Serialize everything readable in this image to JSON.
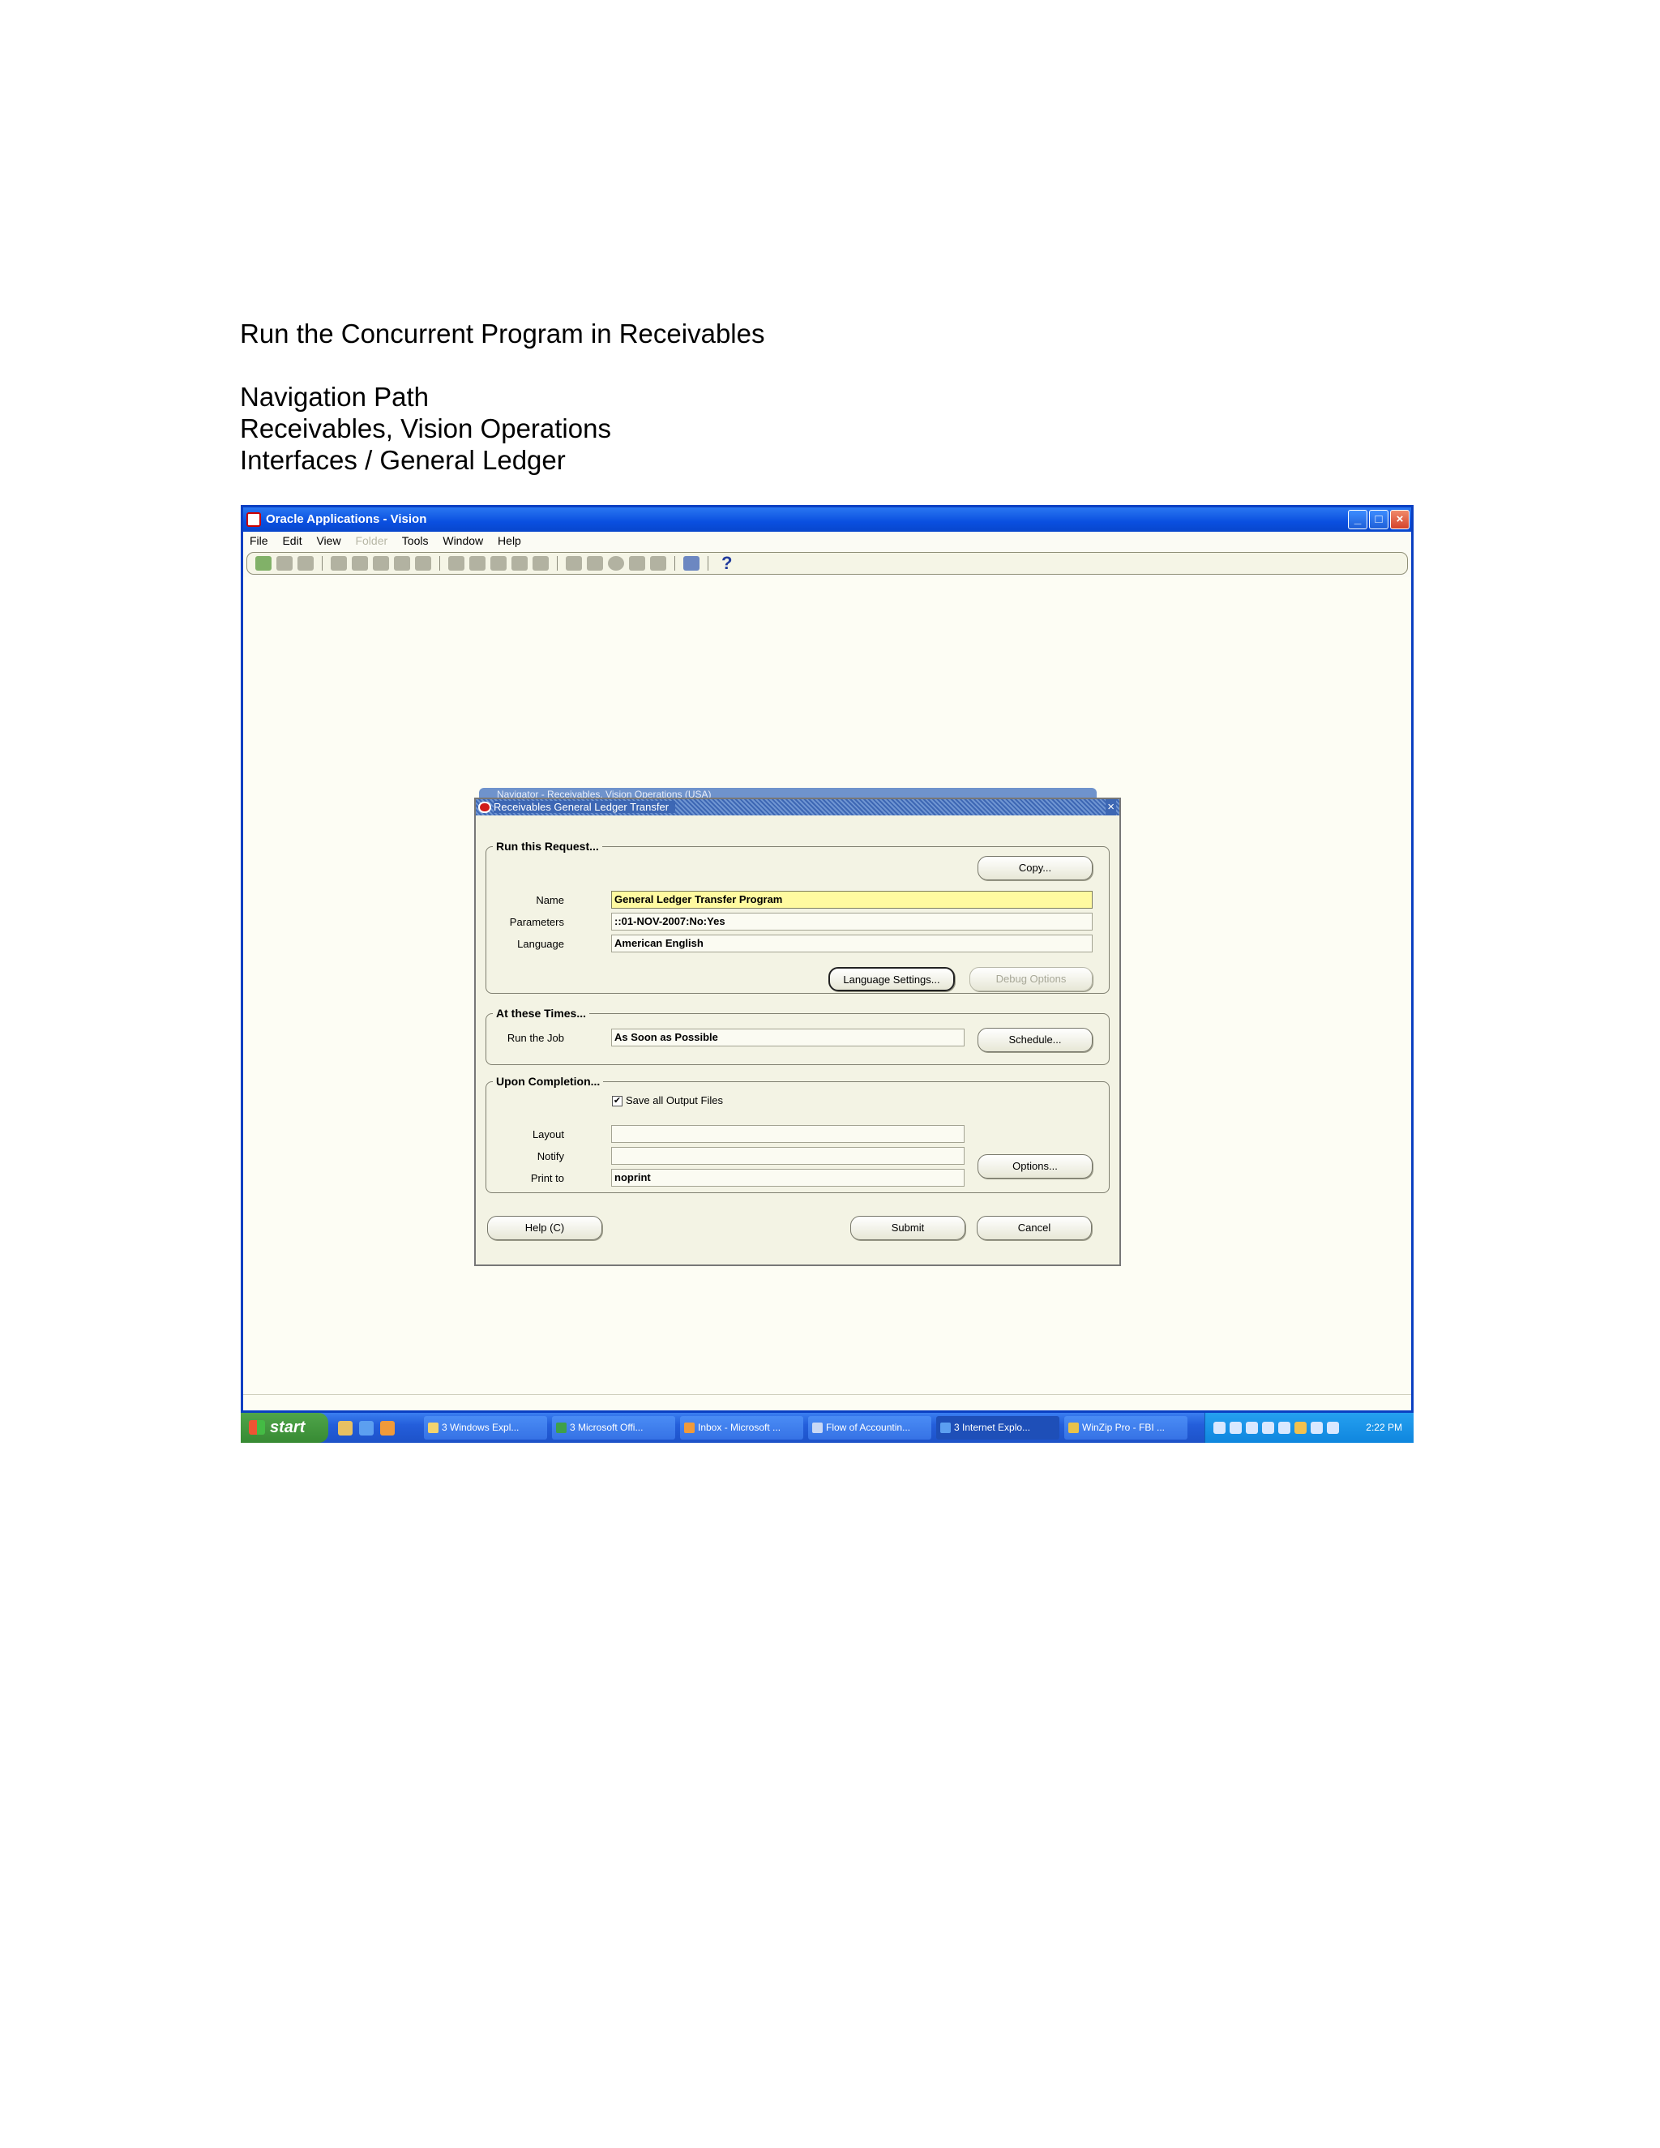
{
  "document": {
    "title": "Run the Concurrent Program in Receivables",
    "nav_heading": "Navigation Path",
    "nav_line_1": "Receivables, Vision Operations",
    "nav_line_2": "Interfaces / General Ledger"
  },
  "app": {
    "title": "Oracle Applications - Vision",
    "menu": [
      "File",
      "Edit",
      "View",
      "Folder",
      "Tools",
      "Window",
      "Help"
    ],
    "help_glyph": "?"
  },
  "navigator": {
    "title": "Navigator - Receivables, Vision Operations (USA)"
  },
  "dialog": {
    "title": "Receivables General Ledger Transfer",
    "close": "×",
    "run_section": {
      "legend": "Run this Request...",
      "copy_button": "Copy...",
      "name_label": "Name",
      "name_value": "General Ledger Transfer Program",
      "parameters_label": "Parameters",
      "parameters_value": "::01-NOV-2007:No:Yes",
      "language_label": "Language",
      "language_value": "American English",
      "language_settings_button": "Language Settings...",
      "debug_options_button": "Debug Options"
    },
    "times_section": {
      "legend": "At these Times...",
      "run_job_label": "Run the Job",
      "run_job_value": "As Soon as Possible",
      "schedule_button": "Schedule..."
    },
    "completion_section": {
      "legend": "Upon Completion...",
      "save_output_label": "Save all Output Files",
      "save_output_checked": "✔",
      "layout_label": "Layout",
      "layout_value": "",
      "notify_label": "Notify",
      "notify_value": "",
      "print_to_label": "Print to",
      "print_to_value": "noprint",
      "options_button": "Options..."
    },
    "help_button": "Help (C)",
    "submit_button": "Submit",
    "cancel_button": "Cancel"
  },
  "taskbar": {
    "start_label": "start",
    "buttons": [
      "3 Windows Expl...",
      "3 Microsoft Offi...",
      "Inbox - Microsoft ...",
      "Flow of Accountin...",
      "3 Internet Explo...",
      "WinZip Pro - FBI ..."
    ],
    "clock": "2:22 PM"
  },
  "colors": {
    "xp_blue": "#0a48d6",
    "required_field": "#fffaa0",
    "dialog_bg": "#f3f3e4"
  }
}
